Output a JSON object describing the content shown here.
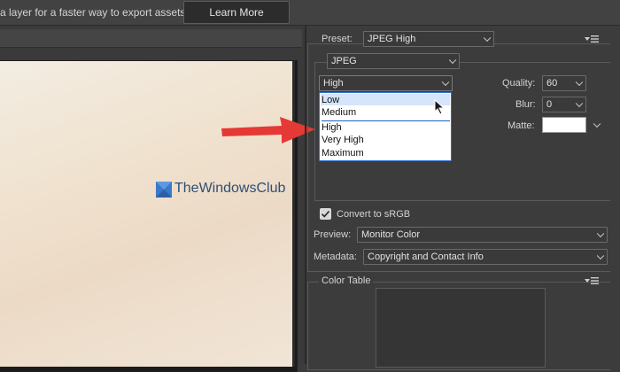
{
  "top_bar": {
    "message": "a layer for a faster way to export assets",
    "learn_more": "Learn More"
  },
  "watermark": {
    "text": "TheWindowsClub"
  },
  "export_panel": {
    "preset_label": "Preset:",
    "preset_value": "JPEG High",
    "format_value": "JPEG",
    "quality_level_value": "High",
    "quality_options": [
      "Low",
      "Medium",
      "High",
      "Very High",
      "Maximum"
    ],
    "highlighted_option": "Low",
    "quality_label": "Quality:",
    "quality_value": "60",
    "blur_label": "Blur:",
    "blur_value": "0",
    "matte_label": "Matte:",
    "matte_color": "#ffffff",
    "convert_srgb_label": "Convert to sRGB",
    "convert_srgb_checked": true,
    "preview_label": "Preview:",
    "preview_value": "Monitor Color",
    "metadata_label": "Metadata:",
    "metadata_value": "Copyright and Contact Info",
    "color_table_label": "Color Table"
  },
  "colors": {
    "panel_bg": "#3c3c3c",
    "accent_blue": "#1f5fc0",
    "arrow_red": "#e53935"
  },
  "icons": [
    "panel-menu-icon",
    "chevron-down-icon",
    "checkbox-icon",
    "cursor-icon",
    "red-arrow",
    "windows-logo"
  ]
}
